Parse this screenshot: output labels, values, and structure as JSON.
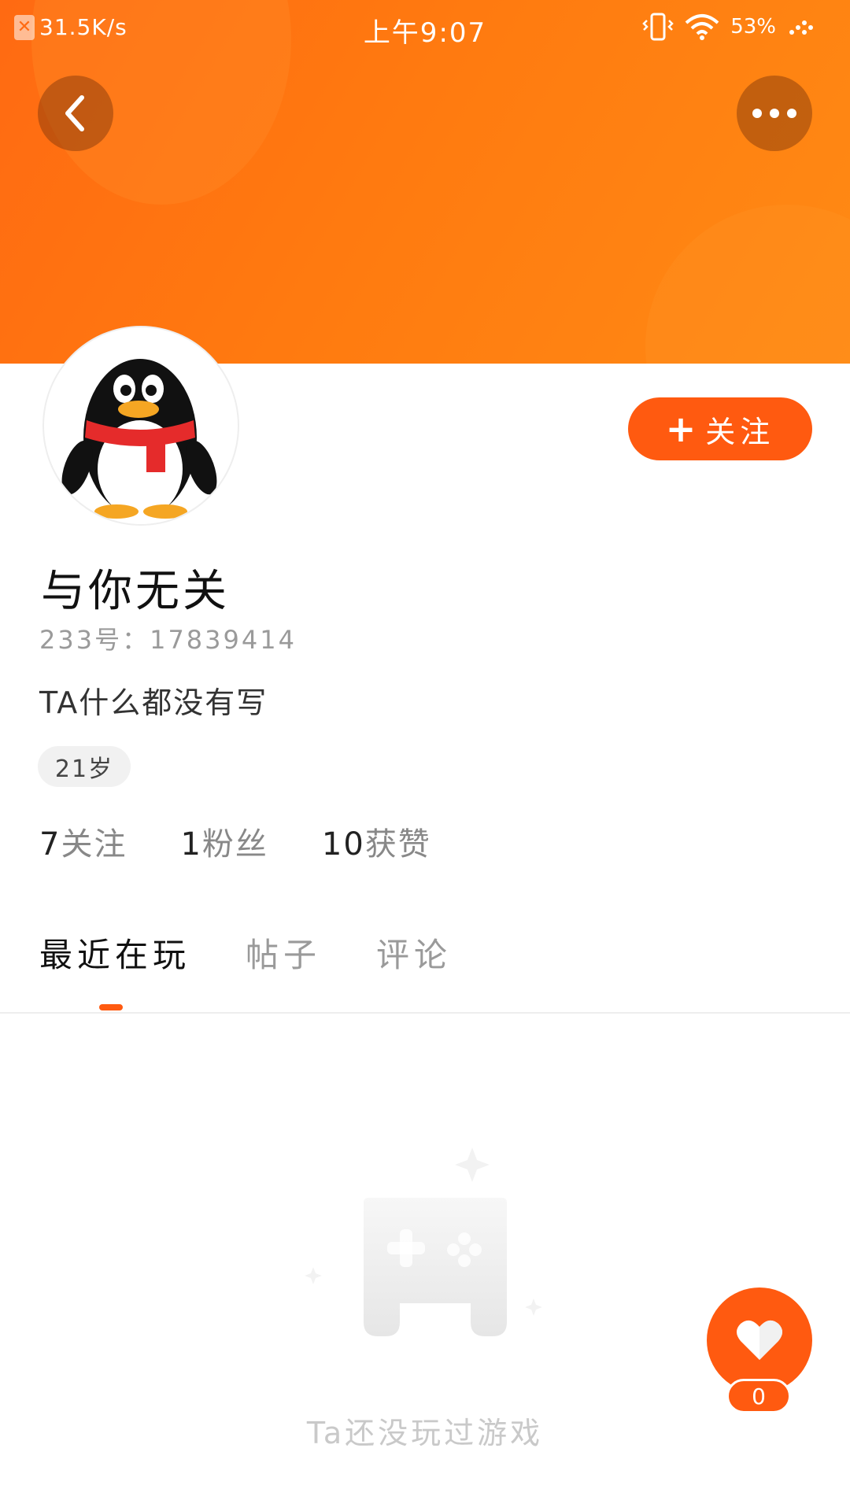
{
  "status_bar": {
    "net_speed": "31.5K/s",
    "time": "上午9:07",
    "battery": "53%"
  },
  "profile": {
    "nickname": "与你无关",
    "user_id": "233号：17839414",
    "bio": "TA什么都没有写",
    "age": "21岁",
    "follow_label": "关注"
  },
  "stats": [
    {
      "num": "7",
      "label": "关注"
    },
    {
      "num": "1",
      "label": "粉丝"
    },
    {
      "num": "10",
      "label": "获赞"
    }
  ],
  "tabs": [
    {
      "label": "最近在玩",
      "active": true
    },
    {
      "label": "帖子",
      "active": false
    },
    {
      "label": "评论",
      "active": false
    }
  ],
  "empty_state": {
    "text": "Ta还没玩过游戏"
  },
  "like": {
    "count": "0"
  },
  "colors": {
    "accent": "#ff5a10",
    "banner": "#ff7a10"
  }
}
